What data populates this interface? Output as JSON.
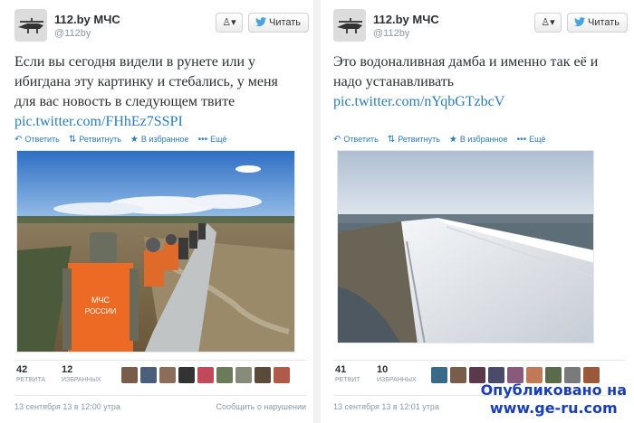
{
  "tweets": [
    {
      "author": {
        "name": "112.by МЧС",
        "handle": "@112by"
      },
      "buttons": {
        "user_menu": "▾",
        "follow": "Читать"
      },
      "text_lines": [
        "Если вы сегодня видели в рунете или у",
        "ибигдана эту картинку и стебались, у меня",
        "для вас новость в следующем твите"
      ],
      "link": "pic.twitter.com/FHhEz7SSPI",
      "actions": {
        "reply": "Ответить",
        "retweet": "Ретвитнуть",
        "favorite": "В избранное",
        "more": "Ещё"
      },
      "photo_labels": {
        "vest_line1": "МЧС",
        "vest_line2": "РОССИИ"
      },
      "stats": {
        "retweets": "42",
        "retweets_label": "РЕТВИТА",
        "favorites": "12",
        "favorites_label": "ИЗБРАННЫХ"
      },
      "faces": [
        "#7a5c4a",
        "#4a5f7a",
        "#8a6e5a",
        "#333333",
        "#c14a5a",
        "#6a7a5a",
        "#8a8a7a",
        "#5a4a3a",
        "#b05a4a"
      ],
      "timestamp": "13 сентября 13 в 12:00 утра",
      "report": "Сообщить о нарушении"
    },
    {
      "author": {
        "name": "112.by МЧС",
        "handle": "@112by"
      },
      "buttons": {
        "user_menu": "▾",
        "follow": "Читать"
      },
      "text_lines": [
        "Это водоналивная дамба и именно так её и",
        "надо устанавливать"
      ],
      "link": "pic.twitter.com/nYqbGTzbcV",
      "actions": {
        "reply": "Ответить",
        "retweet": "Ретвитнуть",
        "favorite": "В избранное",
        "more": "Ещё"
      },
      "stats": {
        "retweets": "41",
        "retweets_label": "РЕТВИТ",
        "favorites": "10",
        "favorites_label": "ИЗБРАННЫХ"
      },
      "faces": [
        "#3a6a8a",
        "#7a5c4a",
        "#5a3a4a",
        "#4a4a6a",
        "#8a5a7a",
        "#c07a5a",
        "#5a6a4a",
        "#7a7a7a",
        "#9a5a3a"
      ],
      "timestamp": "13 сентября 13 в 12:01 утра"
    }
  ],
  "watermark": {
    "line1": "Опубликовано на",
    "line2": "www.ge-ru.com"
  }
}
